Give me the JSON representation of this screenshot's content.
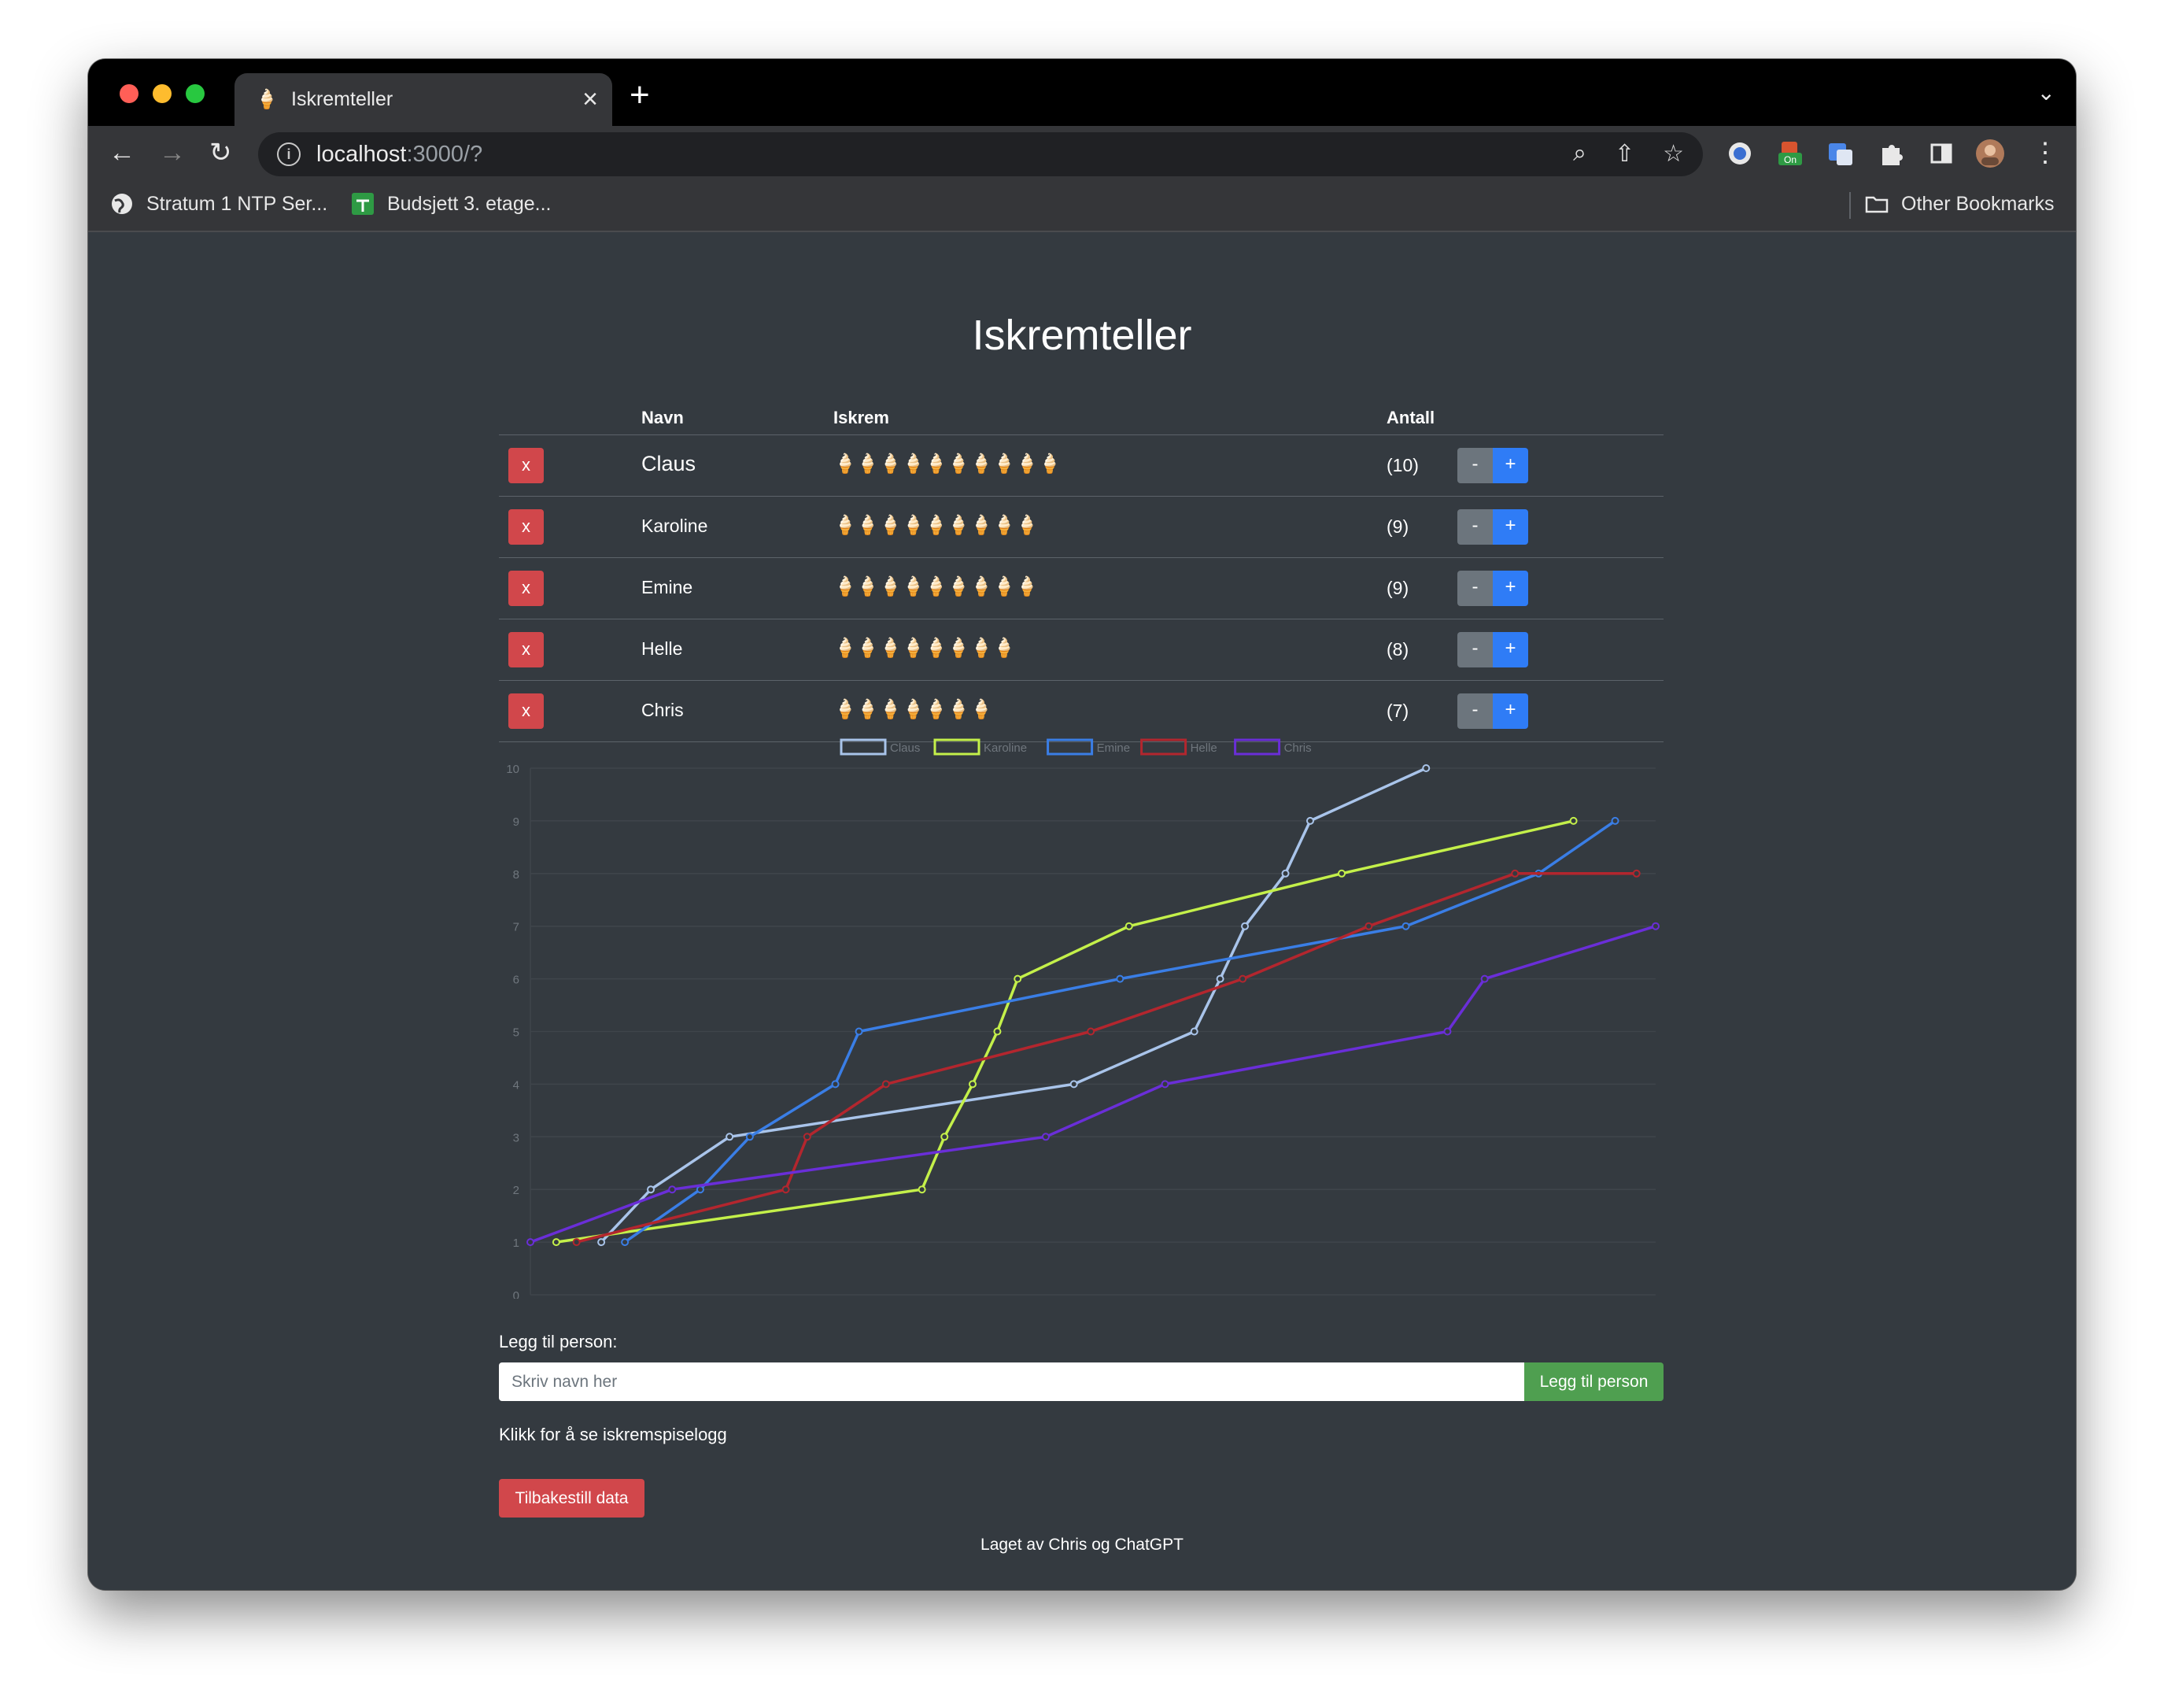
{
  "browser": {
    "tab_title": "Iskremteller",
    "tab_favicon": "🍦",
    "url_host": "localhost",
    "url_path": ":3000/?",
    "bookmarks": [
      {
        "label": "Stratum 1 NTP Ser..."
      },
      {
        "label": "Budsjett 3. etage..."
      }
    ],
    "other_bookmarks": "Other Bookmarks",
    "ext_badge": "On"
  },
  "page": {
    "title": "Iskremteller",
    "columns": {
      "navn": "Navn",
      "iskrem": "Iskrem",
      "antall": "Antall"
    },
    "delete_label": "x",
    "minus_label": "-",
    "plus_label": "+",
    "rows": [
      {
        "name": "Claus",
        "icons": "🍦🍦🍦🍦🍦🍦🍦🍦🍦🍦",
        "count": "(10)"
      },
      {
        "name": "Karoline",
        "icons": "🍦🍦🍦🍦🍦🍦🍦🍦🍦",
        "count": "(9)"
      },
      {
        "name": "Emine",
        "icons": "🍦🍦🍦🍦🍦🍦🍦🍦🍦",
        "count": "(9)"
      },
      {
        "name": "Helle",
        "icons": "🍦🍦🍦🍦🍦🍦🍦🍦",
        "count": "(8)"
      },
      {
        "name": "Chris",
        "icons": "🍦🍦🍦🍦🍦🍦🍦",
        "count": "(7)"
      }
    ],
    "add_label": "Legg til person:",
    "add_placeholder": "Skriv navn her",
    "add_button": "Legg til person",
    "log_link": "Klikk for å se iskremspiselogg",
    "reset_button": "Tilbakestill data",
    "footer": "Laget av Chris og ChatGPT"
  },
  "chart_data": {
    "type": "line",
    "ylim": [
      0,
      10
    ],
    "yticks": [
      0,
      1,
      2,
      3,
      4,
      5,
      6,
      7,
      8,
      9,
      10
    ],
    "x_range": [
      0,
      100
    ],
    "legend_position": "top-center",
    "grid": true,
    "series": [
      {
        "name": "Claus",
        "color": "#a9c4ea",
        "points": [
          [
            6.3,
            1
          ],
          [
            10.7,
            2
          ],
          [
            17.7,
            3
          ],
          [
            48.3,
            4
          ],
          [
            59.0,
            5
          ],
          [
            61.3,
            6
          ],
          [
            63.5,
            7
          ],
          [
            67.1,
            8
          ],
          [
            69.3,
            9
          ],
          [
            79.6,
            10
          ]
        ]
      },
      {
        "name": "Karoline",
        "color": "#c4f04a",
        "points": [
          [
            2.3,
            1
          ],
          [
            34.8,
            2
          ],
          [
            36.8,
            3
          ],
          [
            39.3,
            4
          ],
          [
            41.5,
            5
          ],
          [
            43.3,
            6
          ],
          [
            53.2,
            7
          ],
          [
            72.1,
            8
          ],
          [
            92.7,
            9
          ]
        ]
      },
      {
        "name": "Emine",
        "color": "#3a7ee6",
        "points": [
          [
            8.4,
            1
          ],
          [
            15.1,
            2
          ],
          [
            19.5,
            3
          ],
          [
            27.1,
            4
          ],
          [
            29.2,
            5
          ],
          [
            52.4,
            6
          ],
          [
            77.8,
            7
          ],
          [
            89.6,
            8
          ],
          [
            96.4,
            9
          ]
        ]
      },
      {
        "name": "Helle",
        "color": "#b3262e",
        "points": [
          [
            4.1,
            1
          ],
          [
            22.7,
            2
          ],
          [
            24.6,
            3
          ],
          [
            31.6,
            4
          ],
          [
            49.8,
            5
          ],
          [
            63.3,
            6
          ],
          [
            74.5,
            7
          ],
          [
            87.5,
            8
          ],
          [
            98.3,
            8
          ]
        ]
      },
      {
        "name": "Chris",
        "color": "#6a2ed8",
        "points": [
          [
            0,
            1
          ],
          [
            12.6,
            2
          ],
          [
            45.8,
            3
          ],
          [
            56.4,
            4
          ],
          [
            81.5,
            5
          ],
          [
            84.8,
            6
          ],
          [
            100,
            7
          ]
        ]
      }
    ]
  }
}
